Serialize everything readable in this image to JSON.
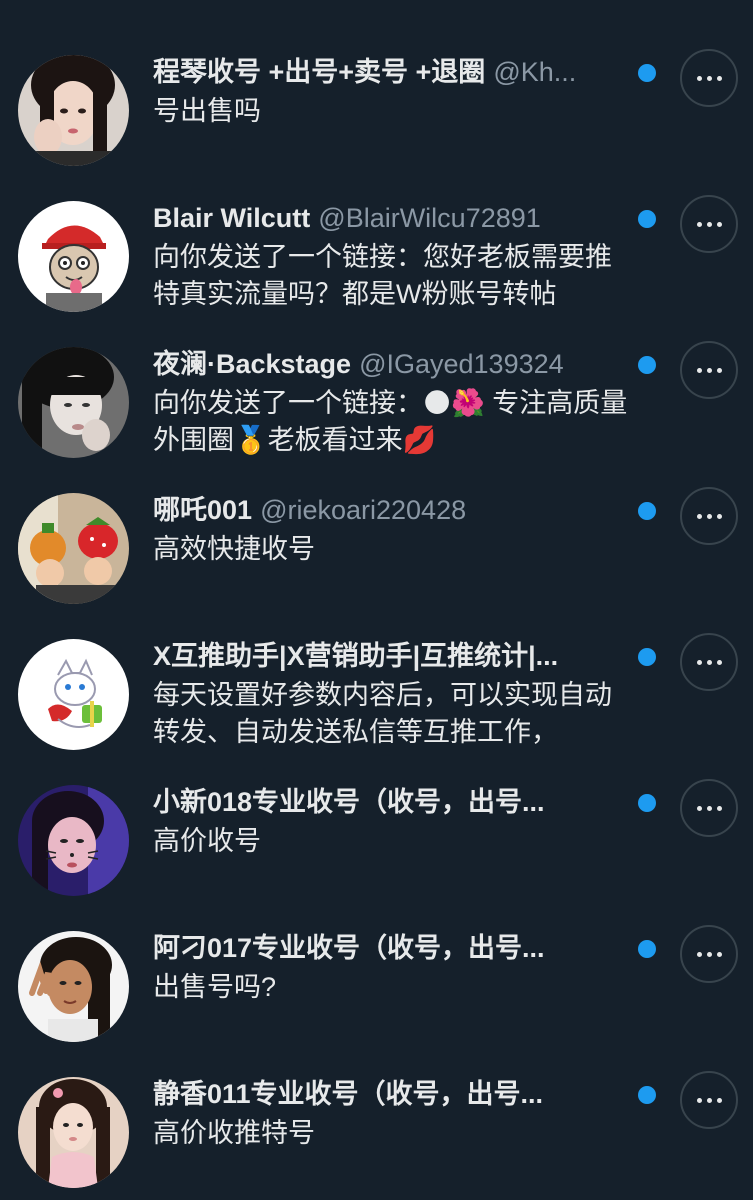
{
  "conversations": [
    {
      "name": "程琴收号 +出号+卖号 +退圈",
      "handle": "@Kh...",
      "message": "号出售吗",
      "avatar": "avatar-woman-hand-face",
      "unread": true
    },
    {
      "name": "Blair Wilcutt",
      "handle": "@BlairWilcu72891",
      "message": "向你发送了一个链接：您好老板需要推特真实流量吗？都是W粉账号转帖",
      "avatar": "avatar-cartoon-ape",
      "unread": true
    },
    {
      "name": "夜澜·Backstage",
      "handle": "@IGayed139324",
      "message": "向你发送了一个链接：🌑🌺 专注高质量外围圈🥇老板看过来💋",
      "avatar": "avatar-woman-dark-hair",
      "unread": true
    },
    {
      "name": "哪吒001",
      "handle": "@riekoari220428",
      "message": "高效快捷收号",
      "avatar": "avatar-kids-fruit-hats",
      "unread": true
    },
    {
      "name": "X互推助手|X营销助手|互推统计|...",
      "handle": "",
      "message": "每天设置好参数内容后，可以实现自动转发、自动发送私信等互推工作，",
      "avatar": "avatar-cartoon-cat",
      "unread": true
    },
    {
      "name": "小新018专业收号（收号，出号...",
      "handle": "",
      "message": "高价收号",
      "avatar": "avatar-woman-purple-light",
      "unread": true
    },
    {
      "name": "阿刁017专业收号（收号，出号...",
      "handle": "",
      "message": "出售号吗?",
      "avatar": "avatar-woman-peace-sign",
      "unread": true
    },
    {
      "name": "静香011专业收号（收号，出号...",
      "handle": "",
      "message": "高价收推特号",
      "avatar": "avatar-woman-long-hair",
      "unread": true
    }
  ],
  "more_button_label": "..."
}
